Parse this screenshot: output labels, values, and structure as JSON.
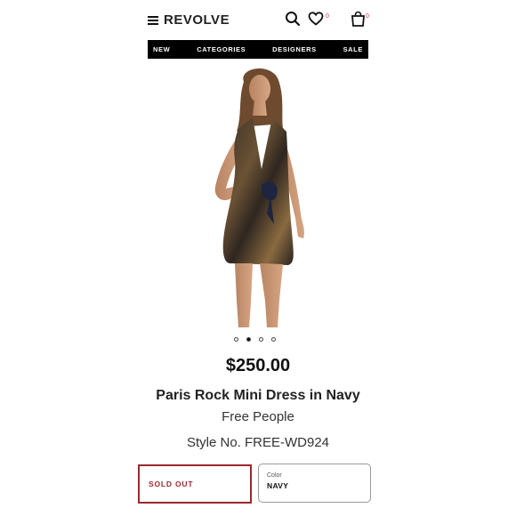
{
  "header": {
    "logo": "REVOLVE",
    "wishlist_count": "0",
    "bag_count": "0"
  },
  "nav": {
    "items": [
      "NEW",
      "CATEGORIES",
      "DESIGNERS",
      "SALE"
    ]
  },
  "gallery": {
    "image_count": 4,
    "active_index": 1
  },
  "product": {
    "price": "$250.00",
    "title": "Paris Rock Mini Dress in Navy",
    "brand": "Free People",
    "style_no": "Style No. FREE-WD924"
  },
  "actions": {
    "sold_out_label": "SOLD OUT",
    "color_label": "Color",
    "color_value": "NAVY"
  },
  "colors": {
    "accent": "#d2357d",
    "sold_out": "#9b2a2a",
    "nav_bg": "#000000"
  }
}
